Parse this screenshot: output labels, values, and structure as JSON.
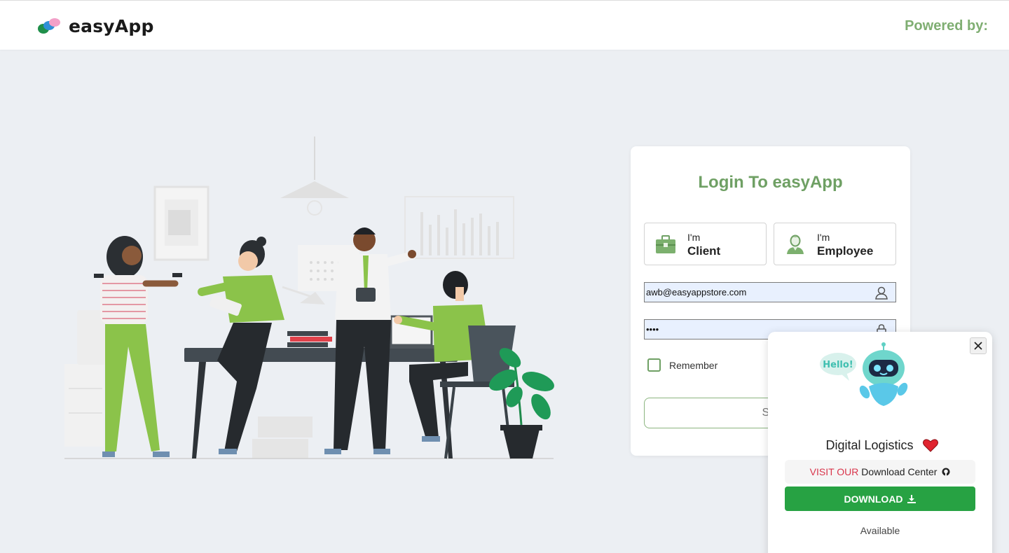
{
  "header": {
    "logo_text": "easyApp",
    "powered_by": "Powered by:"
  },
  "login": {
    "title": "Login To easyApp",
    "roles": [
      {
        "prefix": "I'm",
        "label": "Client",
        "icon": "briefcase-icon"
      },
      {
        "prefix": "I'm",
        "label": "Employee",
        "icon": "user-avatar-icon"
      }
    ],
    "email": {
      "value": "awb@easyappstore.com",
      "icon": "user-icon"
    },
    "password": {
      "value": "••••",
      "icon": "lock-icon"
    },
    "remember_label": "Remember",
    "signin_label": "Sig"
  },
  "popup": {
    "bubble_text": "Hello!",
    "heading": "Digital Logistics",
    "visit_prefix": "VISIT OUR",
    "visit_rest": "Download Center",
    "download_label": "DOWNLOAD",
    "available_label": "Available",
    "icons": [
      "close-icon",
      "robot-icon",
      "heart-icon",
      "github-icon",
      "download-icon"
    ]
  },
  "colors": {
    "accent_green": "#6fa064",
    "illustration_green": "#8bc34a",
    "download_green": "#27a243",
    "visit_red": "#d9354b",
    "page_bg": "#eceff3"
  }
}
